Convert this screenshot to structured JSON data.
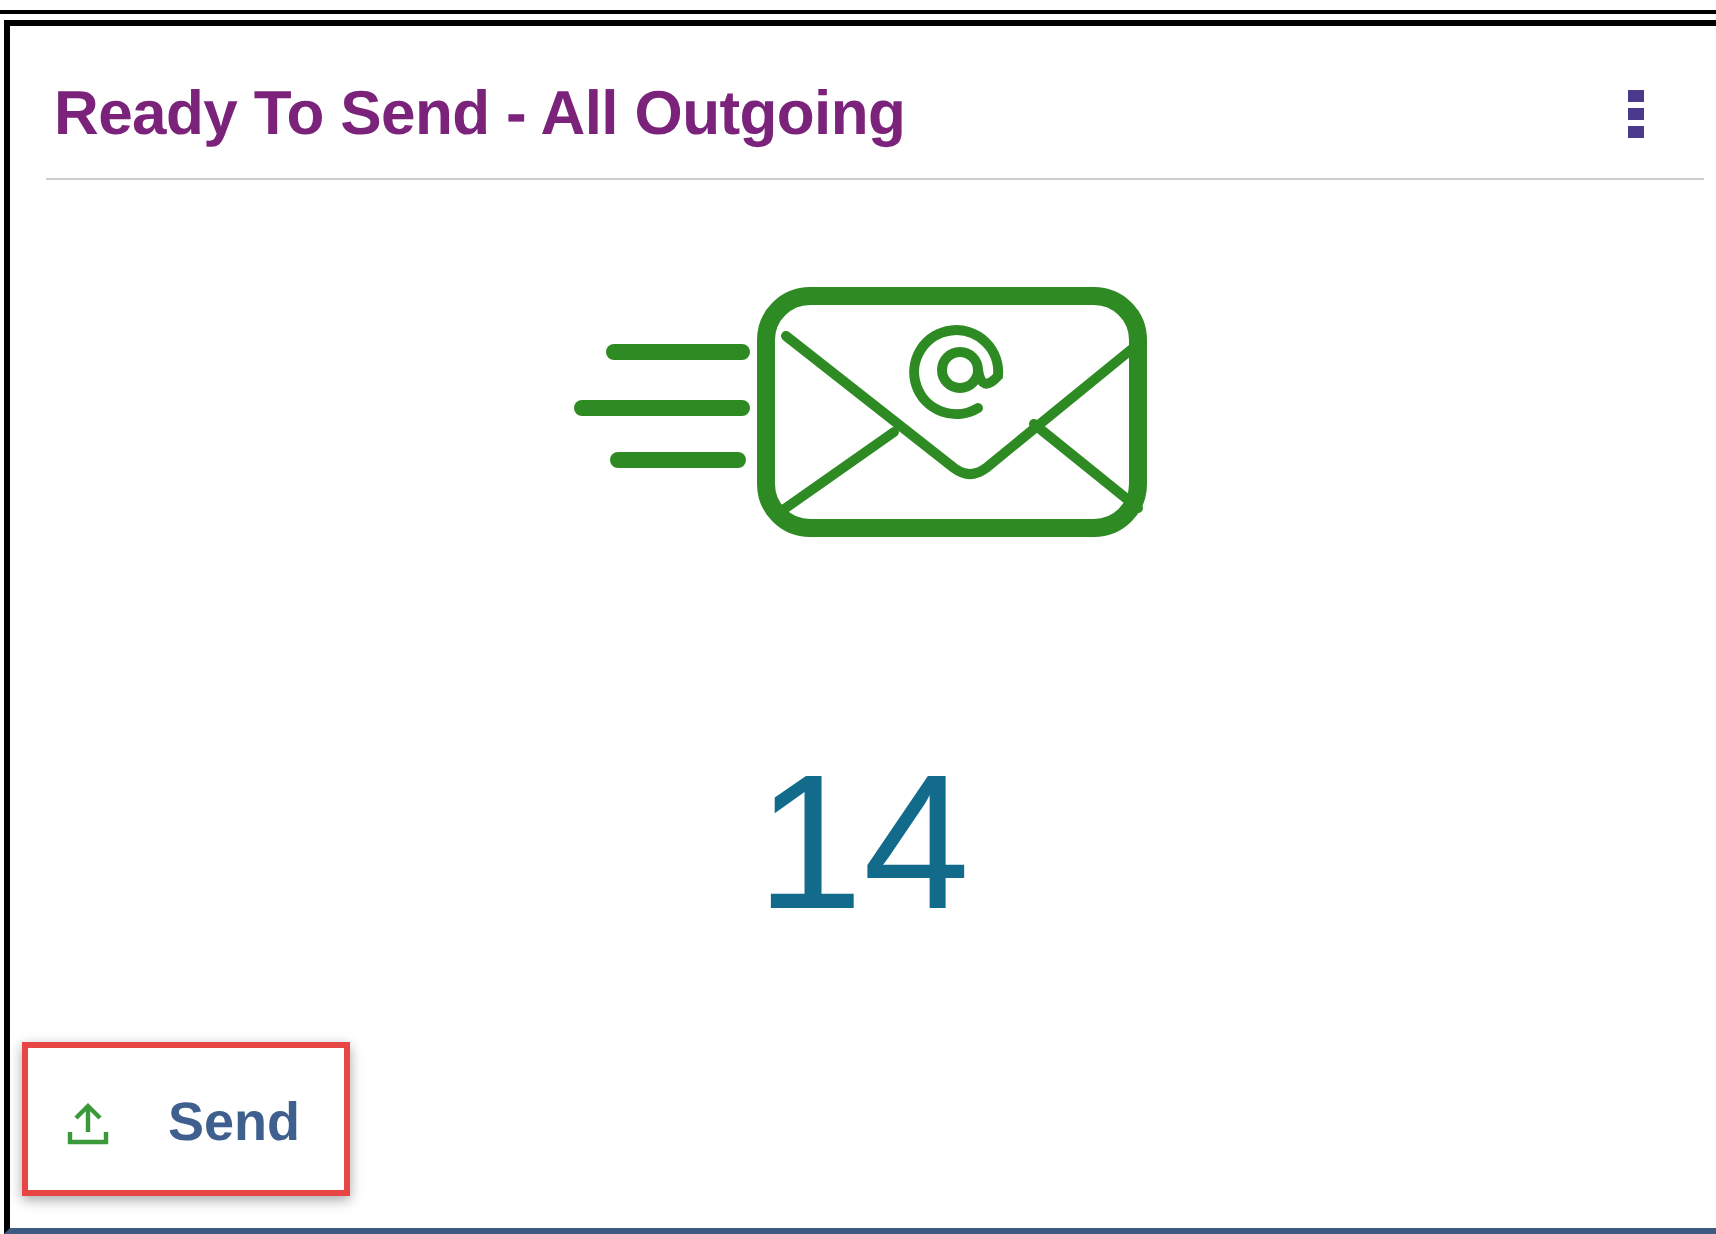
{
  "card": {
    "title": "Ready To Send - All Outgoing",
    "count": "14",
    "actions": [
      {
        "label": "Send",
        "kind": "upload",
        "highlighted": true
      }
    ]
  }
}
